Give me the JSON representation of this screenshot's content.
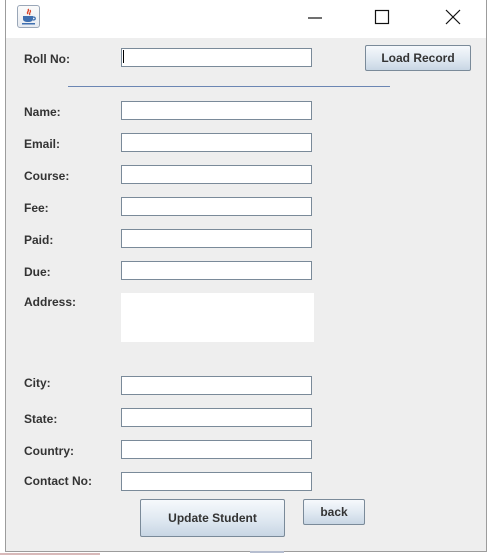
{
  "window": {
    "icons": {
      "app": "java-cup-icon",
      "minimize": "minimize-icon",
      "maximize": "maximize-icon",
      "close": "close-icon"
    }
  },
  "form": {
    "roll_no": {
      "label": "Roll No:",
      "value": ""
    },
    "load_button": "Load Record",
    "fields": {
      "name": {
        "label": "Name:",
        "value": ""
      },
      "email": {
        "label": "Email:",
        "value": ""
      },
      "course": {
        "label": "Course:",
        "value": ""
      },
      "fee": {
        "label": "Fee:",
        "value": ""
      },
      "paid": {
        "label": "Paid:",
        "value": ""
      },
      "due": {
        "label": "Due:",
        "value": ""
      },
      "address": {
        "label": "Address:",
        "value": ""
      },
      "city": {
        "label": "City:",
        "value": ""
      },
      "state": {
        "label": "State:",
        "value": ""
      },
      "country": {
        "label": "Country:",
        "value": ""
      },
      "contact_no": {
        "label": "Contact No:",
        "value": ""
      }
    },
    "update_button": "Update Student",
    "back_button": "back"
  },
  "colors": {
    "window_bg": "#eeeeee",
    "titlebar_bg": "#ffffff",
    "separator": "#6b86b3",
    "button_border": "#7a8a99"
  }
}
